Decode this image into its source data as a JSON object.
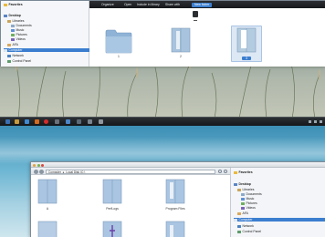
{
  "top_window": {
    "toolbar": {
      "organize": "Organize",
      "open": "Open",
      "include": "Include in library",
      "share": "Share with",
      "new_folder": "New folder"
    },
    "sidebar": {
      "favorites": "Favorites",
      "desktop": "Desktop",
      "libraries": "Libraries",
      "documents": "Documents",
      "music": "Music",
      "pictures": "Pictures",
      "videos": "Videos",
      "user": "AFA",
      "computer": "Computer",
      "network": "Network",
      "control_panel": "Control Panel"
    },
    "files": [
      {
        "name": "1"
      },
      {
        "name": "2"
      },
      {
        "name": "3"
      }
    ]
  },
  "bottom_window": {
    "address": {
      "computer": "Computer",
      "separator": "▸",
      "drive": "Local Disk (C:)"
    },
    "sidebar": {
      "favorites": "Favorites",
      "desktop": "Desktop",
      "libraries": "Libraries",
      "documents": "Documents",
      "music": "Music",
      "pictures": "Pictures",
      "videos": "Videos",
      "user": "AFA",
      "computer": "Computer",
      "network": "Network",
      "control_panel": "Control Panel"
    },
    "folders": [
      {
        "name": "A"
      },
      {
        "name": "PerfLogs"
      },
      {
        "name": "Program Files"
      }
    ]
  },
  "colors": {
    "accent": "#3b7ed0",
    "toolbar": "#1e2124",
    "folder": "#8fb6d9"
  }
}
